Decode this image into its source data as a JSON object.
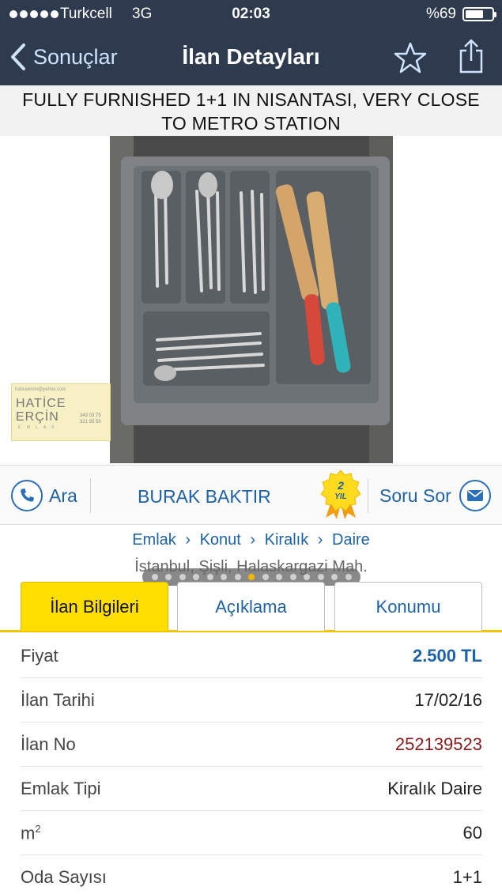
{
  "status_bar": {
    "carrier": "Turkcell",
    "network": "3G",
    "time": "02:03",
    "battery": "%69",
    "battery_level": 0.69
  },
  "nav": {
    "back_label": "Sonuçlar",
    "title": "İlan Detayları",
    "favorite_icon": "star-icon",
    "share_icon": "share-icon"
  },
  "listing": {
    "title_line1": "FULLY FURNISHED 1+1 IN NISANTASI, VERY CLOSE",
    "title_line2": "TO METRO STATION"
  },
  "agency_logo": {
    "line_email": "haticeercin@yahoo.com",
    "name1": "HATİCE",
    "name2": "ERÇİN",
    "subtitle": "E M L A K",
    "phones": "343 03 75\n321 95 50"
  },
  "gallery": {
    "total_photos": 15,
    "active_index": 7
  },
  "contact": {
    "call_label": "Ara",
    "seller_name": "BURAK BAKTIR",
    "badge_top": "2",
    "badge_bottom": "YIL",
    "ask_label": "Soru Sor"
  },
  "breadcrumb": {
    "items": [
      "Emlak",
      "Konut",
      "Kiralık",
      "Daire"
    ],
    "separator": "›",
    "location": "İstanbul, Şişli, Halaskargazi Mah."
  },
  "tabs": [
    {
      "label": "İlan Bilgileri",
      "active": true
    },
    {
      "label": "Açıklama",
      "active": false
    },
    {
      "label": "Konumu",
      "active": false
    }
  ],
  "details": {
    "price_key": "Fiyat",
    "price_value": "2.500 TL",
    "date_key": "İlan Tarihi",
    "date_value": "17/02/16",
    "id_key": "İlan No",
    "id_value": "252139523",
    "type_key": "Emlak Tipi",
    "type_value": "Kiralık Daire",
    "area_key": "m",
    "area_sup": "2",
    "area_value": "60",
    "rooms_key": "Oda Sayısı",
    "rooms_value": "1+1"
  },
  "colors": {
    "nav_bg": "#2e3a4d",
    "link_blue": "#1e62a8",
    "tab_active": "#ffde00",
    "id_red": "#8b1a1a"
  }
}
